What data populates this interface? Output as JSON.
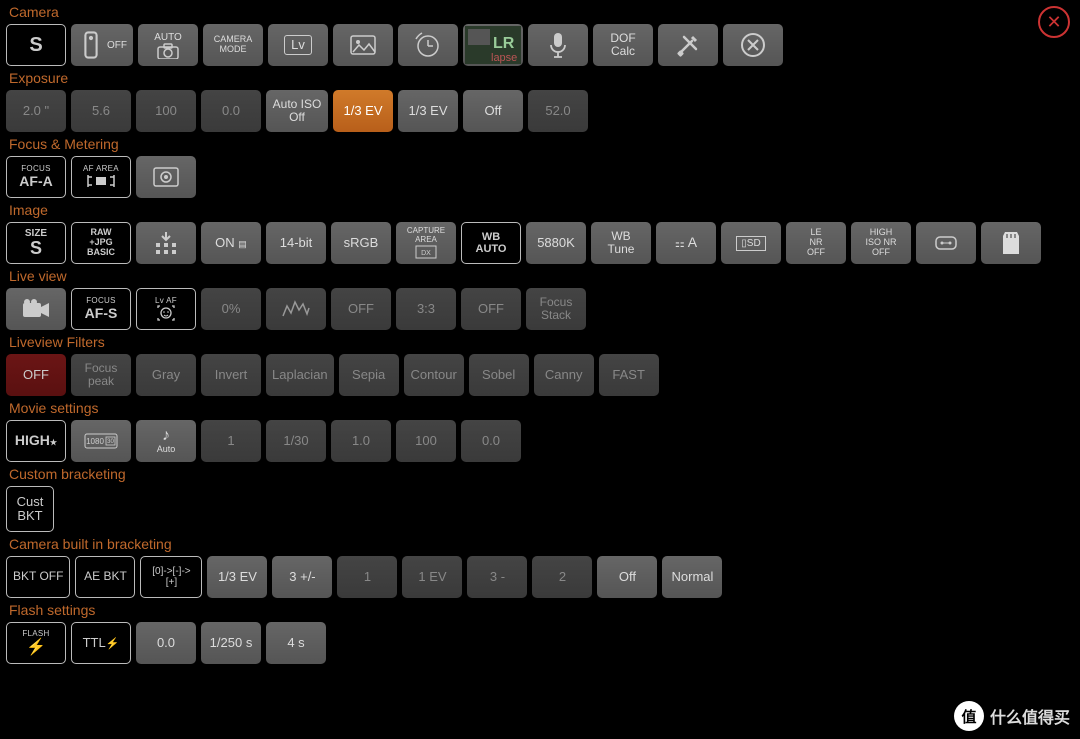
{
  "sections": {
    "camera": {
      "label": "Camera",
      "items": {
        "mode_indicator": "S",
        "remote_off": "OFF",
        "auto_label": "AUTO",
        "camera_mode": "CAMERA\nMODE",
        "lv_button": "Lv",
        "dof_calc": "DOF\nCalc"
      }
    },
    "exposure": {
      "label": "Exposure",
      "items": {
        "shutter": "2.0 \"",
        "aperture": "5.6",
        "iso": "100",
        "ev_comp": "0.0",
        "auto_iso": "Auto ISO Off",
        "ev_step_active": "1/3 EV",
        "ev_step2": "1/3 EV",
        "off": "Off",
        "value": "52.0"
      }
    },
    "focus_metering": {
      "label": "Focus & Metering",
      "items": {
        "focus_label": "FOCUS",
        "focus_mode": "AF-A",
        "af_area_label": "AF AREA"
      }
    },
    "image": {
      "label": "Image",
      "items": {
        "size_label": "SIZE",
        "size_value": "S",
        "raw_jpg": "RAW\n+JPG\nBASIC",
        "onoff": "ON",
        "bit_depth": "14-bit",
        "color_space": "sRGB",
        "capture_area": "CAPTURE\nAREA",
        "wb_label": "WB",
        "wb_mode": "AUTO",
        "wb_kelvin": "5880K",
        "wb_tune": "WB\nTune",
        "picture_ctrl": "A",
        "sd_label": "SD",
        "le_nr_label": "LE\nNR\nOFF",
        "high_iso_nr": "HIGH\nISO NR\nOFF"
      }
    },
    "liveview": {
      "label": "Live view",
      "items": {
        "focus_label": "FOCUS",
        "focus_mode": "AF-S",
        "lv_af_label": "Lv AF",
        "percent": "0%",
        "off1": "OFF",
        "ratio": "3:3",
        "off2": "OFF",
        "focus_stack": "Focus\nStack"
      }
    },
    "lv_filters": {
      "label": "Liveview Filters",
      "items": {
        "off": "OFF",
        "focus_peak": "Focus\npeak",
        "gray": "Gray",
        "invert": "Invert",
        "laplacian": "Laplacian",
        "sepia": "Sepia",
        "contour": "Contour",
        "sobel": "Sobel",
        "canny": "Canny",
        "fast": "FAST"
      }
    },
    "movie": {
      "label": "Movie settings",
      "items": {
        "high": "HIGH",
        "auto": "Auto",
        "v1": "1",
        "v2": "1/30",
        "v3": "1.0",
        "v4": "100",
        "v5": "0.0"
      }
    },
    "custom_bkt": {
      "label": "Custom bracketing",
      "items": {
        "cust_bkt": "Cust\nBKT"
      }
    },
    "camera_bkt": {
      "label": "Camera built in bracketing",
      "items": {
        "bkt_off": "BKT OFF",
        "ae_bkt": "AE BKT",
        "seq": "[0]->[-]->[+]",
        "step": "1/3 EV",
        "range": "3 +/-",
        "v1": "1",
        "v2": "1 EV",
        "v3": "3 -",
        "v4": "2",
        "off": "Off",
        "normal": "Normal"
      }
    },
    "flash": {
      "label": "Flash settings",
      "items": {
        "flash_label": "FLASH",
        "ttl": "TTL",
        "comp": "0.0",
        "sync": "1/250 s",
        "delay": "4 s"
      }
    }
  },
  "watermark": "什么值得买"
}
